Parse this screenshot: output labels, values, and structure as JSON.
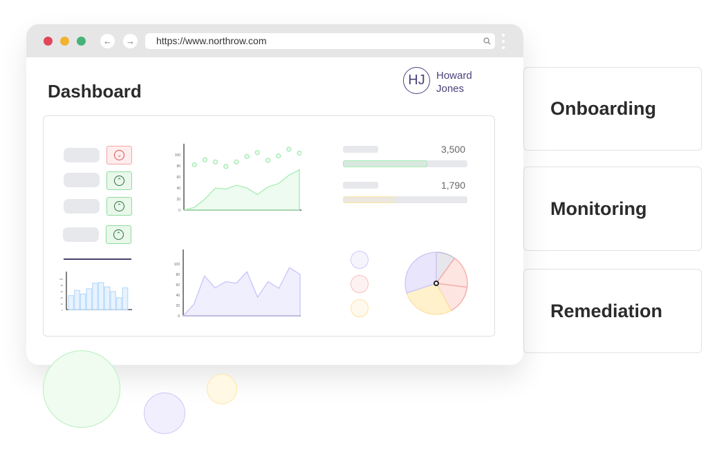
{
  "browser": {
    "url": "https://www.northrow.com",
    "back_icon": "arrow-left",
    "forward_icon": "arrow-right",
    "search_icon": "search",
    "menu_icon": "kebab"
  },
  "header": {
    "title": "Dashboard",
    "user": {
      "initials": "HJ",
      "first": "Howard",
      "last": "Jones"
    }
  },
  "side_cards": [
    {
      "label": "Onboarding"
    },
    {
      "label": "Monitoring"
    },
    {
      "label": "Remediation"
    }
  ],
  "toggles": [
    {
      "state": "down",
      "color": "#f5a3a3"
    },
    {
      "state": "up",
      "color": "#8fdc9c"
    },
    {
      "state": "up",
      "color": "#8fdc9c"
    },
    {
      "state": "up",
      "color": "#8fdc9c"
    }
  ],
  "progress": [
    {
      "value": "3,500",
      "fill": 0.68,
      "color": "#a6ecb2"
    },
    {
      "value": "1,790",
      "fill": 0.43,
      "color": "#fde8a8"
    }
  ],
  "legend_colors": [
    "#cfc8f7",
    "#f7c0bb",
    "#fde2a4"
  ],
  "chart_data": [
    {
      "type": "scatter+area",
      "ylim": [
        0,
        120
      ],
      "yticks": [
        "0",
        "20",
        "40",
        "60",
        "80",
        "100"
      ],
      "points": [
        82,
        91,
        87,
        79,
        87,
        97,
        104,
        90,
        98,
        110,
        103
      ],
      "area": [
        0,
        5,
        20,
        40,
        38,
        45,
        40,
        28,
        42,
        48,
        63,
        73
      ],
      "color": "#a6ecb2"
    },
    {
      "type": "bar",
      "ylim": [
        0,
        120
      ],
      "yticks": [
        "0",
        "20",
        "40",
        "60",
        "80",
        "100"
      ],
      "values": [
        45,
        62,
        50,
        67,
        85,
        87,
        73,
        58,
        38,
        70
      ],
      "color": "#bcdcfb"
    },
    {
      "type": "area",
      "ylim": [
        0,
        120
      ],
      "yticks": [
        "0",
        "20",
        "40",
        "60",
        "80",
        "100"
      ],
      "values": [
        0,
        22,
        77,
        54,
        66,
        63,
        85,
        36,
        66,
        53,
        93,
        80
      ],
      "color": "#c8c2fa"
    },
    {
      "type": "pie",
      "values": [
        10,
        17,
        15,
        28,
        30
      ],
      "colors": [
        "#d6d6de",
        "#fbd3cf",
        "#fbd3cf",
        "#fde7a8",
        "#d9d4fa"
      ]
    }
  ]
}
